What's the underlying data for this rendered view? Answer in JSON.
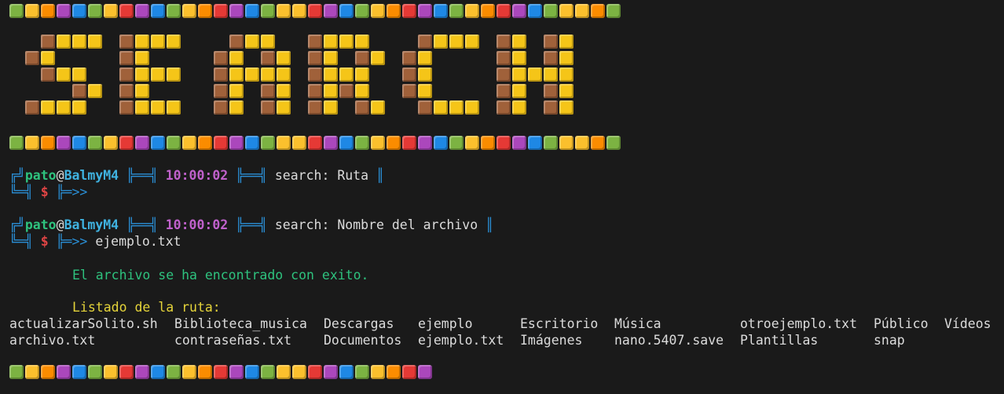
{
  "colors": {
    "block_sequence": [
      "#7cb342",
      "#fbc02d",
      "#fb8c00",
      "#ab47bc",
      "#1e88e5",
      "#7cb342",
      "#fbc02d",
      "#e53935",
      "#ab47bc",
      "#1e88e5",
      "#7cb342",
      "#fbc02d",
      "#fb8c00",
      "#e53935",
      "#ab47bc",
      "#1e88e5",
      "#7cb342",
      "#fbc02d",
      "#fbc02d",
      "#e53935",
      "#ab47bc",
      "#1e88e5",
      "#7cb342",
      "#fbc02d",
      "#fb8c00",
      "#e53935",
      "#ab47bc",
      "#1e88e5",
      "#7cb342",
      "#fbc02d",
      "#fb8c00",
      "#e53935",
      "#ab47bc",
      "#1e88e5",
      "#7cb342",
      "#fbc02d",
      "#fbc02d",
      "#fb8c00"
    ],
    "banner_brown": "#a0613a",
    "banner_yellow": "#f5c518"
  },
  "banner": {
    "word": "SEARCH"
  },
  "prompts": [
    {
      "corner_top": "╔╝",
      "user": "pato",
      "at": "@",
      "host": "BalmyM4",
      "sep": "╠══╣",
      "time": "10:00:02",
      "message": "search: Ruta",
      "end": "║",
      "corner_bottom": "╚═╣",
      "dollar": "$",
      "arrow": "╠═>>",
      "input": ""
    },
    {
      "corner_top": "╔╝",
      "user": "pato",
      "at": "@",
      "host": "BalmyM4",
      "sep": "╠══╣",
      "time": "10:00:02",
      "message": "search: Nombre del archivo",
      "end": "║",
      "corner_bottom": "╚═╣",
      "dollar": "$",
      "arrow": "╠═>>",
      "input": "ejemplo.txt"
    }
  ],
  "found_message": "El archivo se ha encontrado con exito.",
  "listing_title": "Listado de la ruta:",
  "listing": [
    [
      "actualizarSolito.sh",
      "archivo.txt"
    ],
    [
      "Biblioteca_musica",
      "contraseñas.txt"
    ],
    [
      "Descargas",
      "Documentos"
    ],
    [
      "ejemplo",
      "ejemplo.txt"
    ],
    [
      "Escritorio",
      "Imágenes"
    ],
    [
      "Música",
      "nano.5407.save"
    ],
    [
      "otroejemplo.txt",
      "Plantillas"
    ],
    [
      "Público",
      "snap"
    ],
    [
      "Vídeos",
      ""
    ]
  ]
}
